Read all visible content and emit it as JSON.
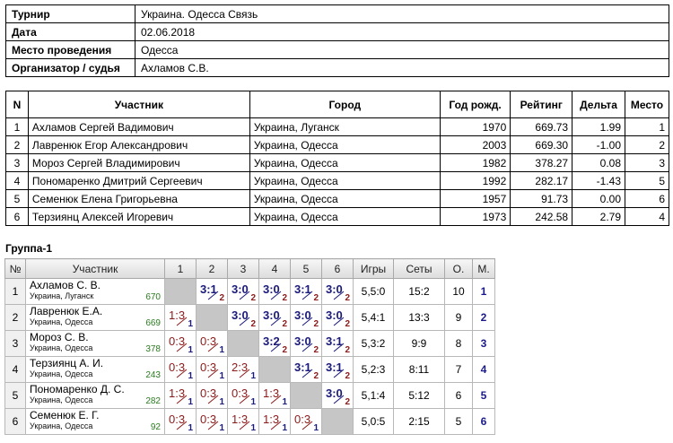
{
  "info": [
    {
      "label": "Турнир",
      "value": "Украина. Одесса Связь"
    },
    {
      "label": "Дата",
      "value": "02.06.2018"
    },
    {
      "label": "Место проведения",
      "value": "Одесса"
    },
    {
      "label": "Организатор / судья",
      "value": "Ахламов С.В."
    }
  ],
  "participants": {
    "headers": [
      "N",
      "Участник",
      "Город",
      "Год рожд.",
      "Рейтинг",
      "Дельта",
      "Место"
    ],
    "rows": [
      [
        "1",
        "Ахламов Сергей Вадимович",
        "Украина, Луганск",
        "1970",
        "669.73",
        "1.99",
        "1"
      ],
      [
        "2",
        "Лавренюк Егор Александрович",
        "Украина, Одесса",
        "2003",
        "669.30",
        "-1.00",
        "2"
      ],
      [
        "3",
        "Мороз Сергей Владимирович",
        "Украина, Одесса",
        "1982",
        "378.27",
        "0.08",
        "3"
      ],
      [
        "4",
        "Пономаренко Дмитрий Сергеевич",
        "Украина, Одесса",
        "1992",
        "282.17",
        "-1.43",
        "5"
      ],
      [
        "5",
        "Семенюк Елена Григорьевна",
        "Украина, Одесса",
        "1957",
        "91.73",
        "0.00",
        "6"
      ],
      [
        "6",
        "Терзиянц Алексей Игоревич",
        "Украина, Одесса",
        "1973",
        "242.58",
        "2.79",
        "4"
      ]
    ]
  },
  "group": {
    "title": "Группа-1",
    "headers": [
      "№",
      "Участник",
      "1",
      "2",
      "3",
      "4",
      "5",
      "6",
      "Игры",
      "Сеты",
      "О.",
      "М."
    ],
    "rows": [
      {
        "n": "1",
        "name": "Ахламов С. В.",
        "city": "Украина, Луганск",
        "rating": "670",
        "cells": [
          null,
          [
            "3:1",
            "2",
            "w"
          ],
          [
            "3:0",
            "2",
            "w"
          ],
          [
            "3:0",
            "2",
            "w"
          ],
          [
            "3:1",
            "2",
            "w"
          ],
          [
            "3:0",
            "2",
            "w"
          ]
        ],
        "games": "5,5:0",
        "sets": "15:2",
        "points": "10",
        "place": "1"
      },
      {
        "n": "2",
        "name": "Лавренюк Е.А.",
        "city": "Украина, Одесса",
        "rating": "669",
        "cells": [
          [
            "1:3",
            "1",
            "l"
          ],
          null,
          [
            "3:0",
            "2",
            "w"
          ],
          [
            "3:0",
            "2",
            "w"
          ],
          [
            "3:0",
            "2",
            "w"
          ],
          [
            "3:0",
            "2",
            "w"
          ]
        ],
        "games": "5,4:1",
        "sets": "13:3",
        "points": "9",
        "place": "2"
      },
      {
        "n": "3",
        "name": "Мороз С. В.",
        "city": "Украина, Одесса",
        "rating": "378",
        "cells": [
          [
            "0:3",
            "1",
            "l"
          ],
          [
            "0:3",
            "1",
            "l"
          ],
          null,
          [
            "3:2",
            "2",
            "w"
          ],
          [
            "3:0",
            "2",
            "w"
          ],
          [
            "3:1",
            "2",
            "w"
          ]
        ],
        "games": "5,3:2",
        "sets": "9:9",
        "points": "8",
        "place": "3"
      },
      {
        "n": "4",
        "name": "Терзиянц А. И.",
        "city": "Украина, Одесса",
        "rating": "243",
        "cells": [
          [
            "0:3",
            "1",
            "l"
          ],
          [
            "0:3",
            "1",
            "l"
          ],
          [
            "2:3",
            "1",
            "l"
          ],
          null,
          [
            "3:1",
            "2",
            "w"
          ],
          [
            "3:1",
            "2",
            "w"
          ]
        ],
        "games": "5,2:3",
        "sets": "8:11",
        "points": "7",
        "place": "4"
      },
      {
        "n": "5",
        "name": "Пономаренко Д. С.",
        "city": "Украина, Одесса",
        "rating": "282",
        "cells": [
          [
            "1:3",
            "1",
            "l"
          ],
          [
            "0:3",
            "1",
            "l"
          ],
          [
            "0:3",
            "1",
            "l"
          ],
          [
            "1:3",
            "1",
            "l"
          ],
          null,
          [
            "3:0",
            "2",
            "w"
          ]
        ],
        "games": "5,1:4",
        "sets": "5:12",
        "points": "6",
        "place": "5"
      },
      {
        "n": "6",
        "name": "Семенюк Е. Г.",
        "city": "Украина, Одесса",
        "rating": "92",
        "cells": [
          [
            "0:3",
            "1",
            "l"
          ],
          [
            "0:3",
            "1",
            "l"
          ],
          [
            "1:3",
            "1",
            "l"
          ],
          [
            "1:3",
            "1",
            "l"
          ],
          [
            "0:3",
            "1",
            "l"
          ],
          null
        ],
        "games": "5,0:5",
        "sets": "2:15",
        "points": "5",
        "place": "6"
      }
    ]
  }
}
